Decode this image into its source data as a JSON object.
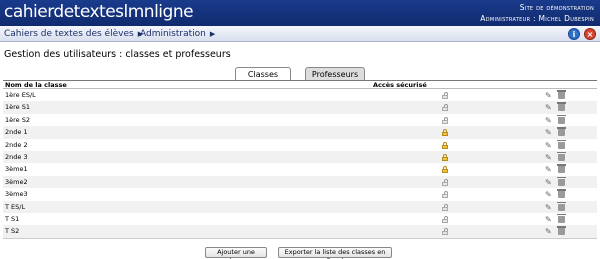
{
  "header": {
    "logo_text": "cahierdetexteslmnligne",
    "site_line1": "Site de démonstration",
    "site_line2": "Administrateur : Michel Dubespin"
  },
  "menu": {
    "item1": "Cahiers de textes des élèves",
    "item2": "Administration",
    "arrow": "▶"
  },
  "page": {
    "title": "Gestion des utilisateurs : classes et professeurs"
  },
  "tabs": {
    "classes": "Classes",
    "professeurs": "Professeurs"
  },
  "table": {
    "col_name": "Nom de la classe",
    "col_access": "Accès sécurisé",
    "rows": [
      {
        "name": "1ère ES/L",
        "lock": "open"
      },
      {
        "name": "1ère S1",
        "lock": "open"
      },
      {
        "name": "1ère S2",
        "lock": "open"
      },
      {
        "name": "2nde 1",
        "lock": "closed"
      },
      {
        "name": "2nde 2",
        "lock": "closed"
      },
      {
        "name": "2nde 3",
        "lock": "closed"
      },
      {
        "name": "3ème1",
        "lock": "closed"
      },
      {
        "name": "3ème2",
        "lock": "open"
      },
      {
        "name": "3ème3",
        "lock": "open"
      },
      {
        "name": "T ES/L",
        "lock": "open"
      },
      {
        "name": "T S1",
        "lock": "open"
      },
      {
        "name": "T S2",
        "lock": "open"
      }
    ]
  },
  "actions": {
    "add_label": "Ajouter une classe",
    "export_label": "Exporter la liste des classes en Excel"
  },
  "icons": {
    "info": "i",
    "close": "×",
    "edit": "✎"
  }
}
